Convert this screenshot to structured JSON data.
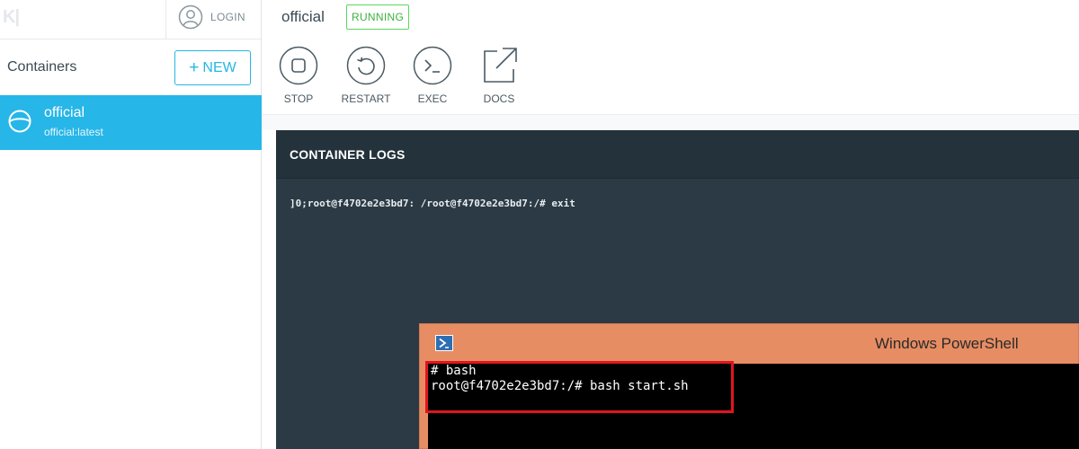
{
  "sidebar": {
    "logo_text": "K|",
    "login_label": "LOGIN",
    "title": "Containers",
    "new_button": {
      "plus": "+",
      "label": "NEW"
    },
    "containers": [
      {
        "name": "official",
        "image": "official:latest",
        "selected": true
      }
    ]
  },
  "header": {
    "title": "official",
    "status": "RUNNING",
    "actions": [
      {
        "label": "STOP",
        "icon": "stop-icon"
      },
      {
        "label": "RESTART",
        "icon": "restart-icon"
      },
      {
        "label": "EXEC",
        "icon": "terminal-icon"
      },
      {
        "label": "DOCS",
        "icon": "external-link-icon"
      }
    ]
  },
  "logs": {
    "title": "CONTAINER LOGS",
    "lines": [
      "]0;root@f4702e2e3bd7: /root@f4702e2e3bd7:/# exit"
    ]
  },
  "powershell": {
    "title": "Windows PowerShell",
    "lines": [
      "# bash",
      "root@f4702e2e3bd7:/# bash start.sh"
    ]
  },
  "colors": {
    "accent": "#27b6e8",
    "status_green": "#3cb23f",
    "logs_bg": "#2b3a44",
    "powershell_titlebar": "#e78d63",
    "highlight_red": "#e0161c"
  }
}
